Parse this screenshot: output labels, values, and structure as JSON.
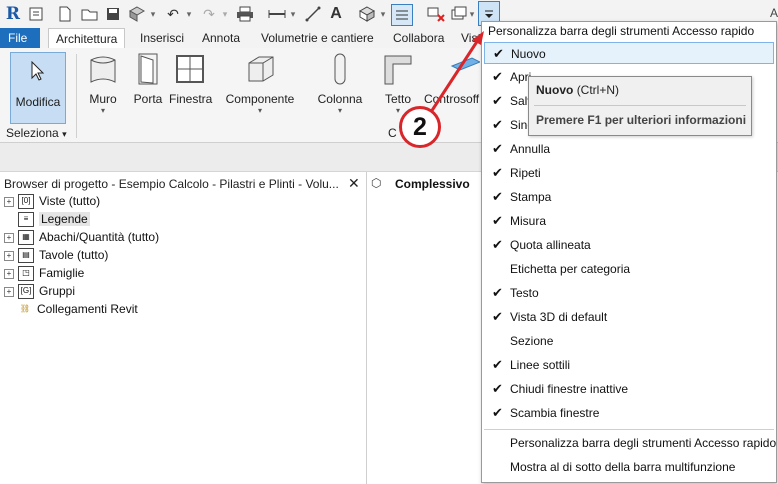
{
  "qat": {
    "logo": "R",
    "right_letter": "A",
    "icons": [
      "revit-logo",
      "info-icon",
      "new-icon",
      "open-icon",
      "save-icon",
      "sync-icon",
      "undo-icon",
      "redo-icon",
      "print-icon",
      "measure-icon",
      "dimension-icon",
      "text-icon",
      "3d-view-icon",
      "thin-lines-icon",
      "close-windows-icon",
      "switch-windows-icon",
      "customize-dropdown-icon"
    ]
  },
  "tabs": [
    "File",
    "Architettura",
    "Inserisci",
    "Annota",
    "Volumetrie e cantiere",
    "Collabora",
    "Vist"
  ],
  "ribbon": {
    "modifica": "Modifica",
    "seleziona": "Seleziona",
    "buttons": [
      "Muro",
      "Porta",
      "Finestra",
      "Componente",
      "Colonna",
      "Tetto",
      "Controsoff"
    ],
    "panel_label_partial": "C"
  },
  "browser": {
    "title": "Browser di progetto - Esempio Calcolo - Pilastri e Plinti - Volu...",
    "items": [
      {
        "label": "Viste (tutto)"
      },
      {
        "label": "Legende"
      },
      {
        "label": "Abachi/Quantità (tutto)"
      },
      {
        "label": "Tavole (tutto)"
      },
      {
        "label": "Famiglie"
      },
      {
        "label": "Gruppi"
      },
      {
        "label": "Collegamenti Revit"
      }
    ]
  },
  "view": {
    "tab_label": "Complessivo"
  },
  "menu": {
    "header": "Personalizza barra degli strumenti Accesso rapido",
    "items": [
      {
        "label": "Nuovo",
        "checked": true
      },
      {
        "label": "Apri",
        "checked": true
      },
      {
        "label": "Salva",
        "checked": true
      },
      {
        "label": "Sincronizza",
        "checked": true
      },
      {
        "label": "Annulla",
        "checked": true
      },
      {
        "label": "Ripeti",
        "checked": true
      },
      {
        "label": "Stampa",
        "checked": true
      },
      {
        "label": "Misura",
        "checked": true
      },
      {
        "label": "Quota allineata",
        "checked": true
      },
      {
        "label": "Etichetta per categoria",
        "checked": false
      },
      {
        "label": "Testo",
        "checked": true
      },
      {
        "label": "Vista 3D di default",
        "checked": true
      },
      {
        "label": "Sezione",
        "checked": false
      },
      {
        "label": "Linee sottili",
        "checked": true
      },
      {
        "label": "Chiudi finestre inattive",
        "checked": true
      },
      {
        "label": "Scambia finestre",
        "checked": true
      }
    ],
    "footer": [
      "Personalizza barra degli strumenti Accesso rapido",
      "Mostra al di sotto della barra multifunzione"
    ],
    "check_glyph": "✔"
  },
  "tooltip": {
    "title": "Nuovo",
    "shortcut": "(Ctrl+N)",
    "help": "Premere F1 per ulteriori informazioni"
  },
  "callout": {
    "number": "2",
    "color": "#d8262a"
  }
}
